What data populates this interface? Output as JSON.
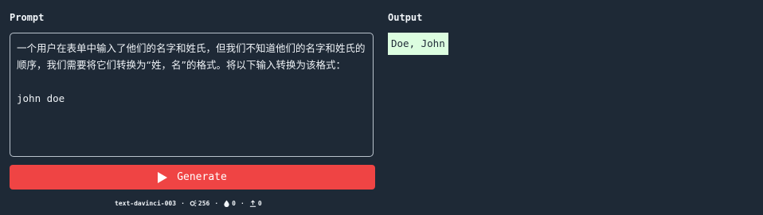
{
  "labels": {
    "prompt": "Prompt",
    "output": "Output"
  },
  "prompt": {
    "instruction": "一个用户在表单中输入了他们的名字和姓氏，但我们不知道他们的名字和姓氏的顺序，我们需要将它们转换为“姓，名”的格式。将以下输入转换为该格式：",
    "input": "john doe"
  },
  "output": {
    "text": "Doe, John"
  },
  "generate_button": {
    "label": "Generate",
    "icon": "play-icon"
  },
  "meta": {
    "model": "text-davinci-003",
    "max_tokens": "256",
    "temperature": "0",
    "top_p": "0",
    "separator": "·"
  },
  "colors": {
    "background": "#1e2936",
    "accent": "#ef4444",
    "output_bg": "#dcfde0"
  }
}
